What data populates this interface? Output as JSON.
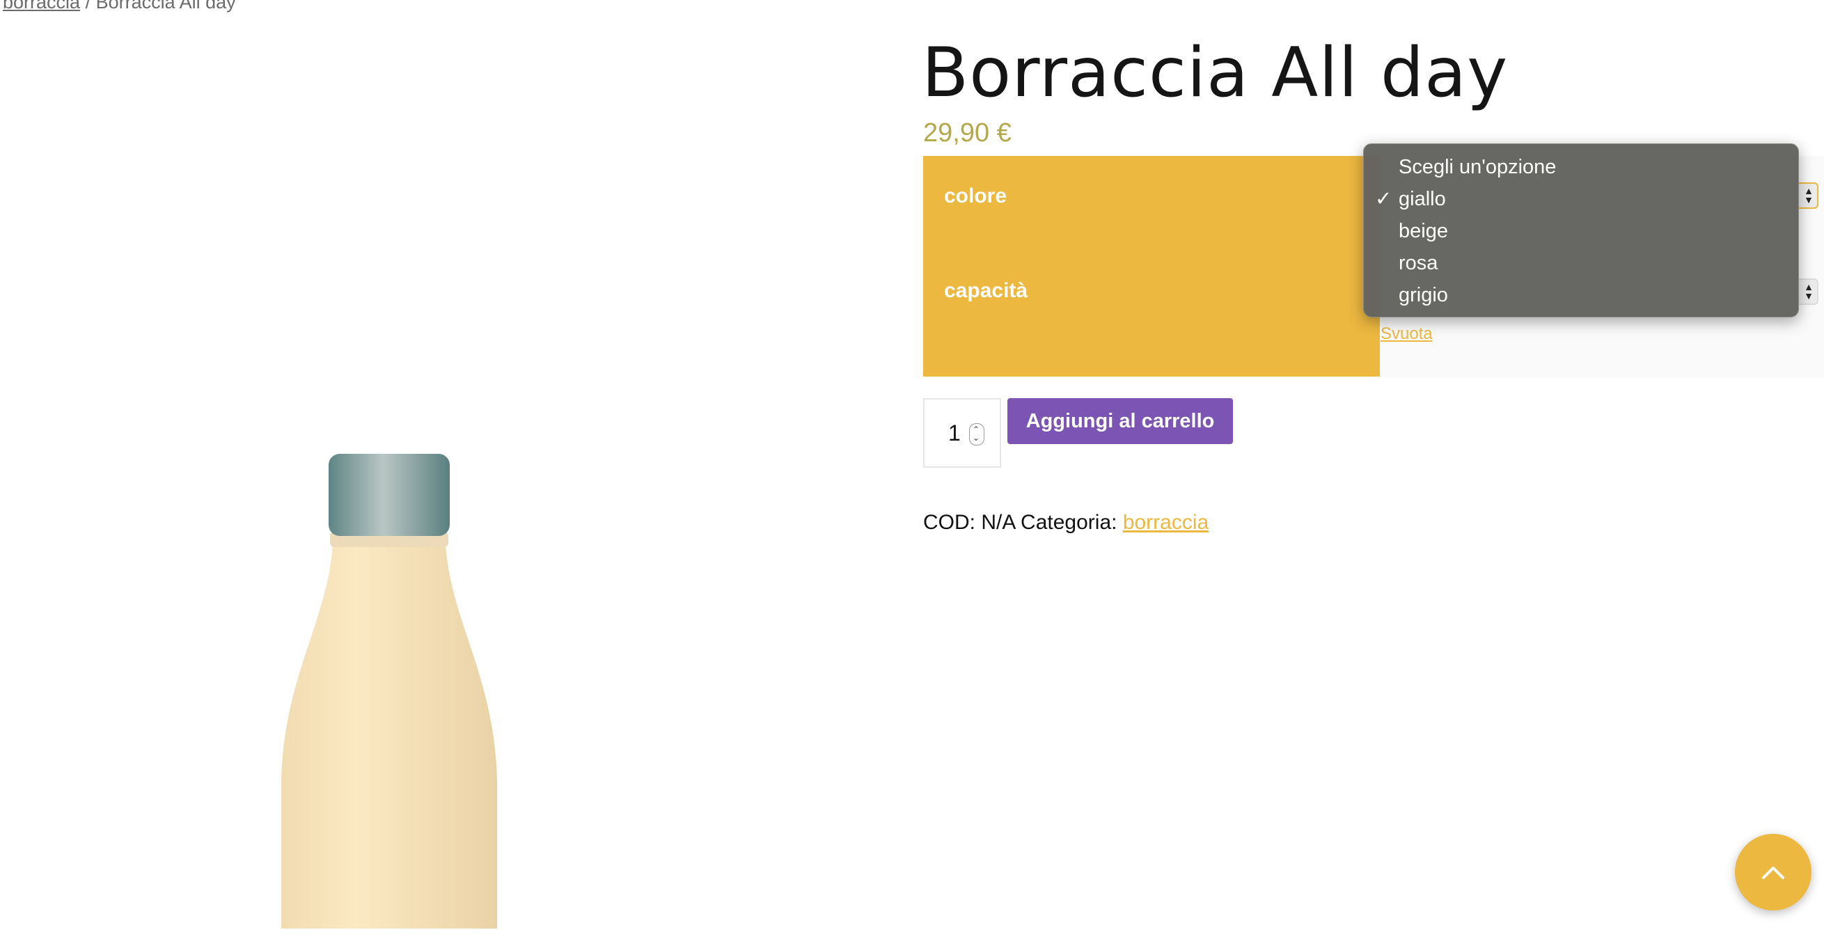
{
  "breadcrumb": {
    "parent": "borraccia",
    "separator": "/",
    "current": "Borraccia All day"
  },
  "product": {
    "title": "Borraccia All day",
    "price": "29,90 €"
  },
  "variations": {
    "color_label": "colore",
    "capacity_label": "capacità",
    "reset_label": "Svuota"
  },
  "dropdown": {
    "options": [
      "Scegli un'opzione",
      "giallo",
      "beige",
      "rosa",
      "grigio"
    ],
    "selected": "giallo",
    "check_glyph": "✓"
  },
  "cart": {
    "quantity": "1",
    "add_button": "Aggiungi al carrello"
  },
  "meta": {
    "sku_text": "COD: N/A",
    "category_label": "Categoria:",
    "category_link": "borraccia"
  },
  "icons": {
    "scroll_top": "chevron-up-icon",
    "bottle": "product-bottle-image"
  },
  "colors": {
    "accent": "#edb840",
    "button": "#7c54b3",
    "price": "#b4a94a"
  }
}
